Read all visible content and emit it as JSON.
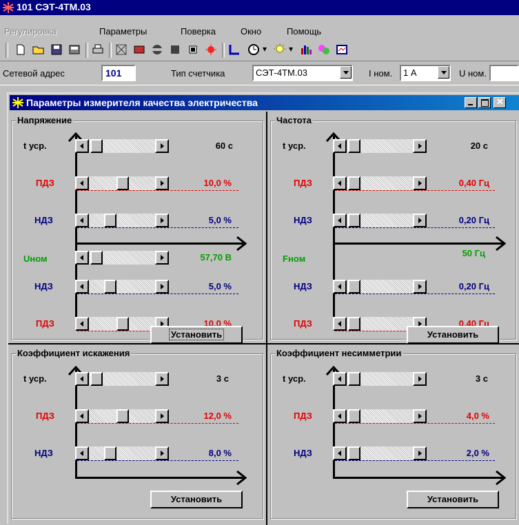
{
  "app": {
    "title": "101  СЭТ-4ТМ.03"
  },
  "menu": [
    "Регулировка",
    "Параметры",
    "Поверка",
    "Окно",
    "Помощь"
  ],
  "toolbar_icons": [
    "new-icon",
    "open-icon",
    "save-icon",
    "device-icon",
    "print-icon",
    "tool1-icon",
    "tool2-icon",
    "tool3-icon",
    "tool4-icon",
    "tool5-icon",
    "tool6-icon",
    "chart-icon",
    "clock-icon",
    "light-icon",
    "bars-icon",
    "palette-icon",
    "report-icon"
  ],
  "addr": {
    "net_label": "Сетевой адрес",
    "net_value": "101",
    "meter_label": "Тип счетчика",
    "meter_value": "СЭТ-4ТМ.03",
    "inom_label": "I ном.",
    "inom_value": "1 А",
    "unom_label": "U ном."
  },
  "child": {
    "title": "Параметры измерителя качества электричества",
    "colors": {
      "red": "#e00000",
      "blue": "#000080",
      "green": "#00a000"
    }
  },
  "panels": {
    "voltage": {
      "title": "Напряжение",
      "t_label": "t уср.",
      "t_value": "60 с",
      "pdz1_label": "ПДЗ",
      "pdz1_value": "10,0 %",
      "ndz1_label": "НДЗ",
      "ndz1_value": "5,0 %",
      "nom_label": "Uном",
      "nom_value": "57,70 В",
      "ndz2_label": "НДЗ",
      "ndz2_value": "5,0 %",
      "pdz2_label": "ПДЗ",
      "pdz2_value": "10,0 %",
      "button": "Установить"
    },
    "frequency": {
      "title": "Частота",
      "t_label": "t уср.",
      "t_value": "20 с",
      "pdz1_label": "ПДЗ",
      "pdz1_value": "0,40 Гц",
      "ndz1_label": "НДЗ",
      "ndz1_value": "0,20 Гц",
      "nom_label": "Fном",
      "nom_value": "50 Гц",
      "ndz2_label": "НДЗ",
      "ndz2_value": "0,20 Гц",
      "pdz2_label": "ПДЗ",
      "pdz2_value": "0,40 Гц",
      "button": "Установить"
    },
    "distortion": {
      "title": "Коэффициент искажения",
      "t_label": "t уср.",
      "t_value": "3 с",
      "pdz_label": "ПДЗ",
      "pdz_value": "12,0 %",
      "ndz_label": "НДЗ",
      "ndz_value": "8,0 %",
      "button": "Установить"
    },
    "asymmetry": {
      "title": "Коэффициент несимметрии",
      "t_label": "t уср.",
      "t_value": "3 с",
      "pdz_label": "ПДЗ",
      "pdz_value": "4,0 %",
      "ndz_label": "НДЗ",
      "ndz_value": "2,0 %",
      "button": "Установить"
    }
  }
}
